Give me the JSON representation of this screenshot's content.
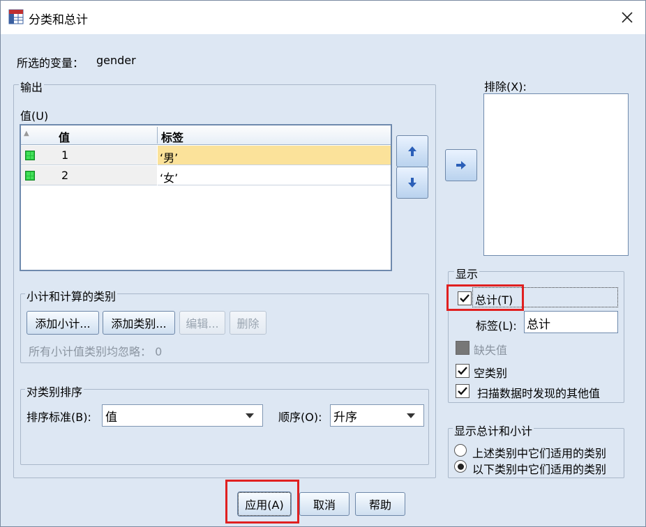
{
  "window": {
    "title": "分类和总计"
  },
  "selected_variable": {
    "label": "所选的变量：",
    "value": "gender"
  },
  "output": {
    "legend": "输出",
    "values_label": "值(U)",
    "table": {
      "headers": [
        "值",
        "标签"
      ],
      "rows": [
        {
          "value": "1",
          "label": "‘男’"
        },
        {
          "value": "2",
          "label": "‘女’"
        }
      ]
    }
  },
  "exclude": {
    "label": "排除(X):"
  },
  "subtotals": {
    "legend": "小计和计算的类别",
    "buttons": {
      "add_subtotal": "添加小计...",
      "add_category": "添加类别...",
      "edit": "编辑...",
      "delete": "删除"
    },
    "note": "所有小计值类别均忽略： 0"
  },
  "sort": {
    "legend": "对类别排序",
    "by_label": "排序标准(B):",
    "by_value": "值",
    "order_label": "顺序(O):",
    "order_value": "升序"
  },
  "display": {
    "legend": "显示",
    "total_label": "总计(T)",
    "total_checked": true,
    "label_field_label": "标签(L):",
    "label_field_value": "总计",
    "missing_label": "缺失值",
    "empty_label": "空类别",
    "scan_label": "扫描数据时发现的其他值"
  },
  "display_totals": {
    "legend": "显示总计和小计",
    "above": "上述类别中它们适用的类别",
    "below": "以下类别中它们适用的类别",
    "selected": "below"
  },
  "footer": {
    "apply": "应用(A)",
    "cancel": "取消",
    "help": "帮助"
  },
  "colors": {
    "highlight_red": "#e02020",
    "selected_row": "#fbe29a"
  }
}
